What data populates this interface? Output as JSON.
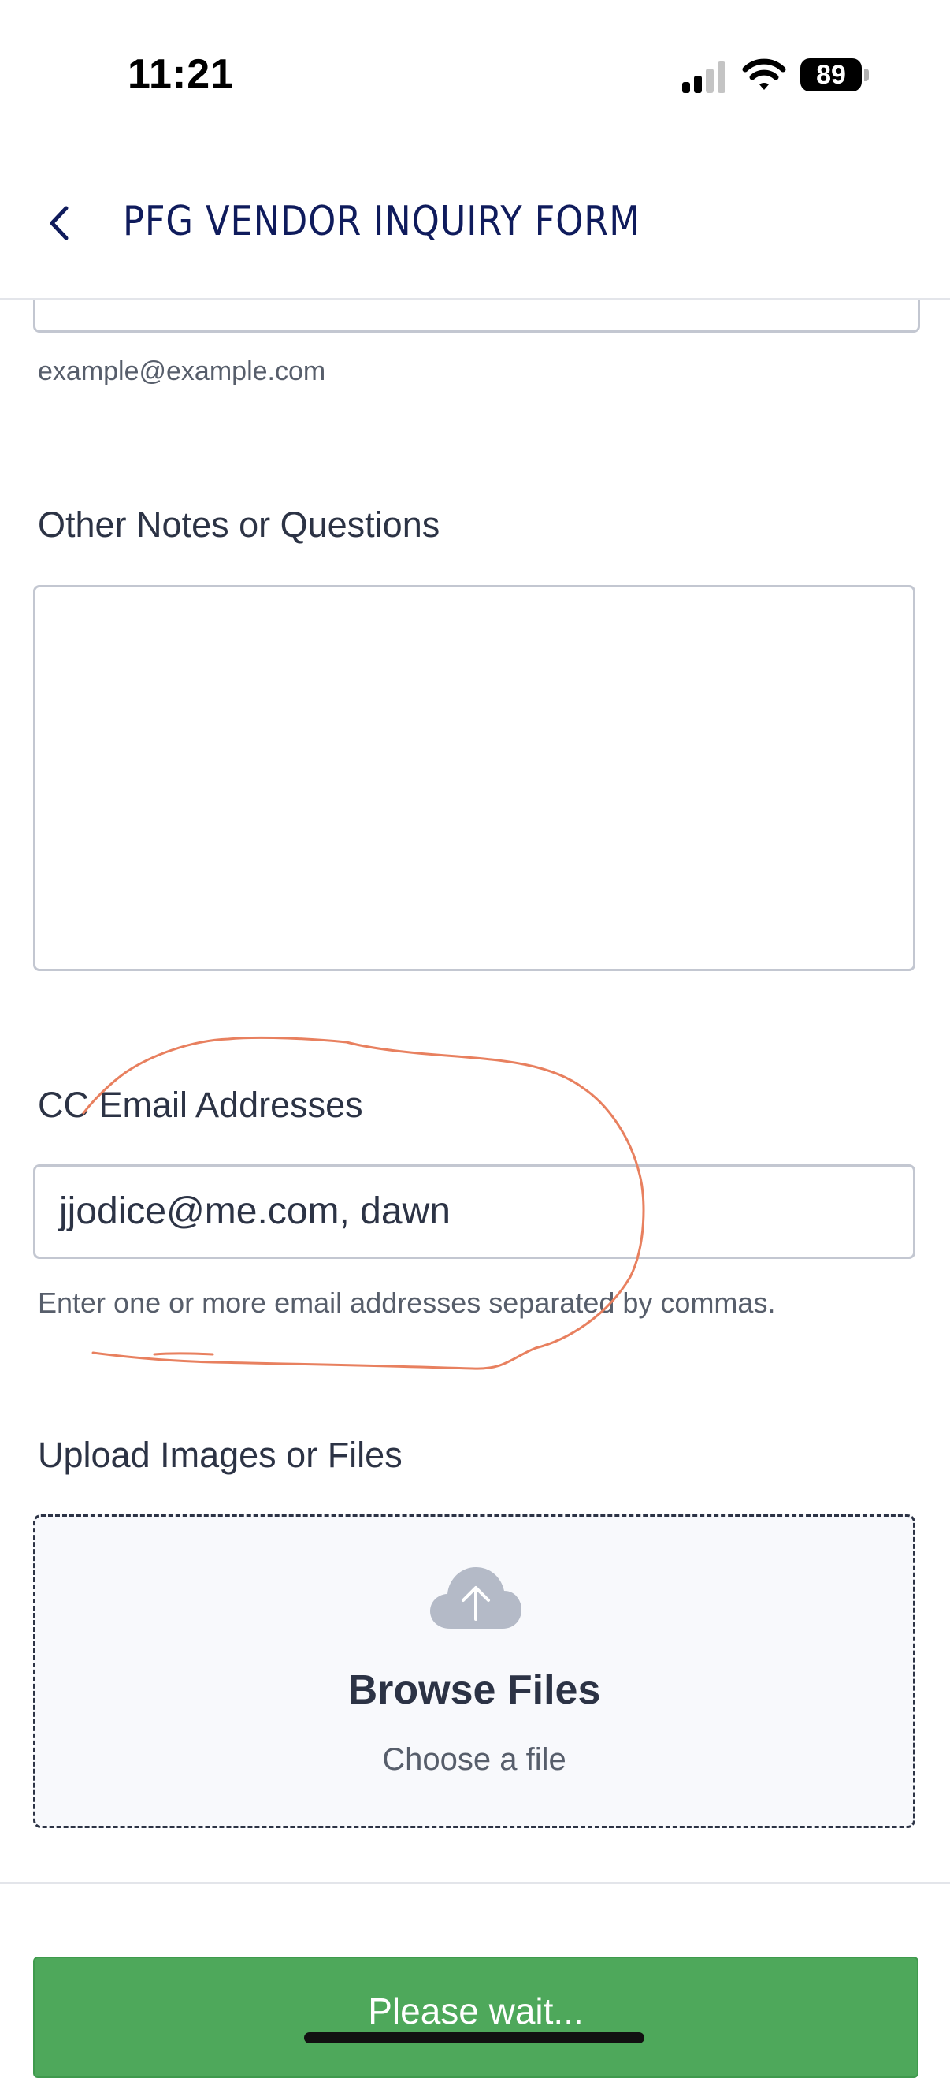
{
  "status_bar": {
    "time": "11:21",
    "battery": "89",
    "icons": [
      "signal-icon",
      "wifi-icon",
      "battery-icon"
    ]
  },
  "nav": {
    "title": "PFG VENDOR INQUIRY FORM",
    "back_icon": "chevron-left-icon"
  },
  "email_field": {
    "sublabel": "example@example.com"
  },
  "notes_field": {
    "label": "Other Notes or Questions",
    "value": ""
  },
  "cc_field": {
    "label": "CC Email Addresses",
    "value": "jjodice@me.com, dawn",
    "help": "Enter one or more email addresses separated by commas."
  },
  "upload": {
    "label": "Upload Images or Files",
    "title": "Browse Files",
    "subtitle": "Choose a file",
    "icon": "cloud-upload-icon"
  },
  "submit": {
    "label": "Please wait..."
  },
  "colors": {
    "accent_green": "#4ea85b",
    "nav_title": "#0f1b5c",
    "annotation": "#e8805f"
  }
}
